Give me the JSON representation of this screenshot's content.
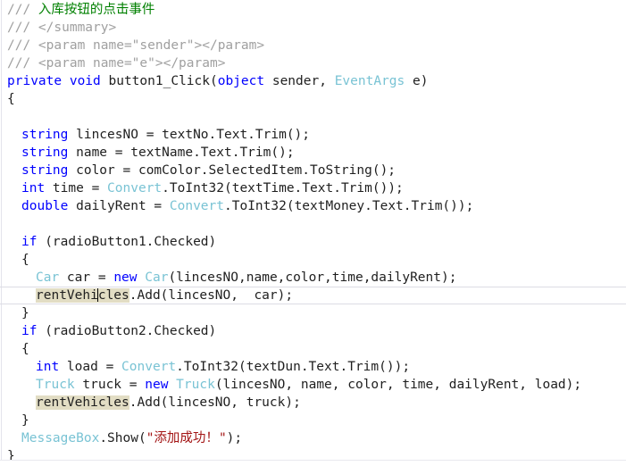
{
  "editor": {
    "language": "csharp",
    "background_color": "#ffffff",
    "current_line_index": 15,
    "highlighted_symbol": "rentVehicles",
    "caret_in_symbol_after": "rentVehi",
    "colors": {
      "keyword": "#0000ff",
      "type": "#79c3d4",
      "string": "#a31515",
      "comment": "#008000",
      "doc_comment": "#a0a0a0",
      "plain_text": "#1f1f1f",
      "reference_highlight": "#e2ddc4",
      "current_line_border": "#dcdce4"
    }
  },
  "lines": [
    {
      "indent": 8,
      "parts": [
        {
          "cls": "doc",
          "t": "/// "
        },
        {
          "cls": "cmt",
          "t": "入库按钮的点击事件",
          "cjk": true
        }
      ]
    },
    {
      "indent": 8,
      "parts": [
        {
          "cls": "doc",
          "t": "/// </summary>"
        }
      ]
    },
    {
      "indent": 8,
      "parts": [
        {
          "cls": "doc",
          "t": "/// <param name=\"sender\"></param>"
        }
      ]
    },
    {
      "indent": 8,
      "parts": [
        {
          "cls": "doc",
          "t": "/// <param name=\"e\"></param>"
        }
      ]
    },
    {
      "indent": 8,
      "parts": [
        {
          "cls": "kw",
          "t": "private void"
        },
        {
          "cls": "plain",
          "t": " button1_Click("
        },
        {
          "cls": "kw",
          "t": "object"
        },
        {
          "cls": "plain",
          "t": " sender, "
        },
        {
          "cls": "type",
          "t": "EventArgs"
        },
        {
          "cls": "plain",
          "t": " e)"
        }
      ]
    },
    {
      "indent": 8,
      "parts": [
        {
          "cls": "plain",
          "t": "{"
        }
      ]
    },
    {
      "indent": 0,
      "parts": []
    },
    {
      "indent": 24,
      "parts": [
        {
          "cls": "kw",
          "t": "string"
        },
        {
          "cls": "plain",
          "t": " lincesNO = textNo.Text.Trim();"
        }
      ]
    },
    {
      "indent": 24,
      "parts": [
        {
          "cls": "kw",
          "t": "string"
        },
        {
          "cls": "plain",
          "t": " name = textName.Text.Trim();"
        }
      ]
    },
    {
      "indent": 24,
      "parts": [
        {
          "cls": "kw",
          "t": "string"
        },
        {
          "cls": "plain",
          "t": " color = comColor.SelectedItem.ToString();"
        }
      ]
    },
    {
      "indent": 24,
      "parts": [
        {
          "cls": "kw",
          "t": "int"
        },
        {
          "cls": "plain",
          "t": " time = "
        },
        {
          "cls": "type",
          "t": "Convert"
        },
        {
          "cls": "plain",
          "t": ".ToInt32(textTime.Text.Trim());"
        }
      ]
    },
    {
      "indent": 24,
      "parts": [
        {
          "cls": "kw",
          "t": "double"
        },
        {
          "cls": "plain",
          "t": " dailyRent = "
        },
        {
          "cls": "type",
          "t": "Convert"
        },
        {
          "cls": "plain",
          "t": ".ToInt32(textMoney.Text.Trim());"
        }
      ]
    },
    {
      "indent": 0,
      "parts": []
    },
    {
      "indent": 24,
      "parts": [
        {
          "cls": "kw",
          "t": "if"
        },
        {
          "cls": "plain",
          "t": " (radioButton1.Checked)"
        }
      ]
    },
    {
      "indent": 24,
      "parts": [
        {
          "cls": "plain",
          "t": "{"
        }
      ]
    },
    {
      "indent": 40,
      "parts": [
        {
          "cls": "type",
          "t": "Car"
        },
        {
          "cls": "plain",
          "t": " car = "
        },
        {
          "cls": "kw",
          "t": "new"
        },
        {
          "cls": "plain",
          "t": " "
        },
        {
          "cls": "type",
          "t": "Car"
        },
        {
          "cls": "plain",
          "t": "(lincesNO,name,color,time,dailyRent);"
        }
      ]
    },
    {
      "indent": 40,
      "current": true,
      "parts": [
        {
          "cls": "plain",
          "t": "rentVehi",
          "hl": true
        },
        {
          "caret": true
        },
        {
          "cls": "plain",
          "t": "cles",
          "hl": true
        },
        {
          "cls": "plain",
          "t": ".Add(lincesNO,  car);"
        }
      ]
    },
    {
      "indent": 24,
      "parts": [
        {
          "cls": "plain",
          "t": "}"
        }
      ]
    },
    {
      "indent": 24,
      "parts": [
        {
          "cls": "kw",
          "t": "if"
        },
        {
          "cls": "plain",
          "t": " (radioButton2.Checked)"
        }
      ]
    },
    {
      "indent": 24,
      "parts": [
        {
          "cls": "plain",
          "t": "{"
        }
      ]
    },
    {
      "indent": 40,
      "parts": [
        {
          "cls": "kw",
          "t": "int"
        },
        {
          "cls": "plain",
          "t": " load = "
        },
        {
          "cls": "type",
          "t": "Convert"
        },
        {
          "cls": "plain",
          "t": ".ToInt32(textDun.Text.Trim());"
        }
      ]
    },
    {
      "indent": 40,
      "parts": [
        {
          "cls": "type",
          "t": "Truck"
        },
        {
          "cls": "plain",
          "t": " truck = "
        },
        {
          "cls": "kw",
          "t": "new"
        },
        {
          "cls": "plain",
          "t": " "
        },
        {
          "cls": "type",
          "t": "Truck"
        },
        {
          "cls": "plain",
          "t": "(lincesNO, name, color, time, dailyRent, load);"
        }
      ]
    },
    {
      "indent": 40,
      "parts": [
        {
          "cls": "plain",
          "t": "rentVehicles",
          "hl": true
        },
        {
          "cls": "plain",
          "t": ".Add(lincesNO, truck);"
        }
      ]
    },
    {
      "indent": 24,
      "parts": [
        {
          "cls": "plain",
          "t": "}"
        }
      ]
    },
    {
      "indent": 24,
      "parts": [
        {
          "cls": "type",
          "t": "MessageBox"
        },
        {
          "cls": "plain",
          "t": ".Show("
        },
        {
          "cls": "str",
          "t": "\""
        },
        {
          "cls": "str",
          "t": "添加成功！",
          "cjk": true
        },
        {
          "cls": "str",
          "t": "\""
        },
        {
          "cls": "plain",
          "t": ");"
        }
      ]
    },
    {
      "indent": 8,
      "parts": [
        {
          "cls": "plain",
          "t": "}"
        }
      ]
    }
  ]
}
